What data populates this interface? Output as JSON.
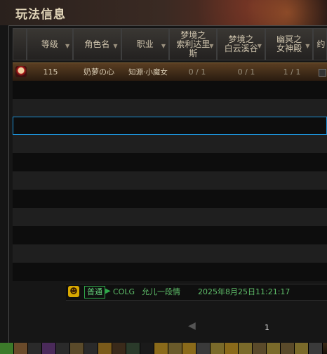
{
  "window": {
    "title": "玩法信息"
  },
  "table": {
    "headers": [
      {
        "label": "",
        "sortable": false
      },
      {
        "label": "等级",
        "sortable": true
      },
      {
        "label": "角色名",
        "sortable": true
      },
      {
        "label": "职业",
        "sortable": true
      },
      {
        "label": "梦境之\n索利达里\n斯",
        "sortable": true
      },
      {
        "label": "梦境之\n白云溪谷",
        "sortable": true
      },
      {
        "label": "幽冥之\n女神殿",
        "sortable": true
      },
      {
        "label": "约",
        "sortable": false
      }
    ],
    "rows": [
      {
        "level": "115",
        "name": "奶萝の心",
        "job": "知源·小魔女",
        "dream1": "0 / 1",
        "dream2": "0 / 1",
        "nether": "1 / 1"
      }
    ]
  },
  "chat": {
    "icon": "smiley-icon",
    "channel": "普通",
    "sender": "COLG",
    "message": "允儿一段情",
    "timestamp": "2025年8月25日11:21:17"
  },
  "pager": {
    "page": "1"
  },
  "colors": {
    "selected_row": "#5a3e22",
    "outline": "#1c8fd4",
    "chat_green": "#5fbf6a"
  }
}
